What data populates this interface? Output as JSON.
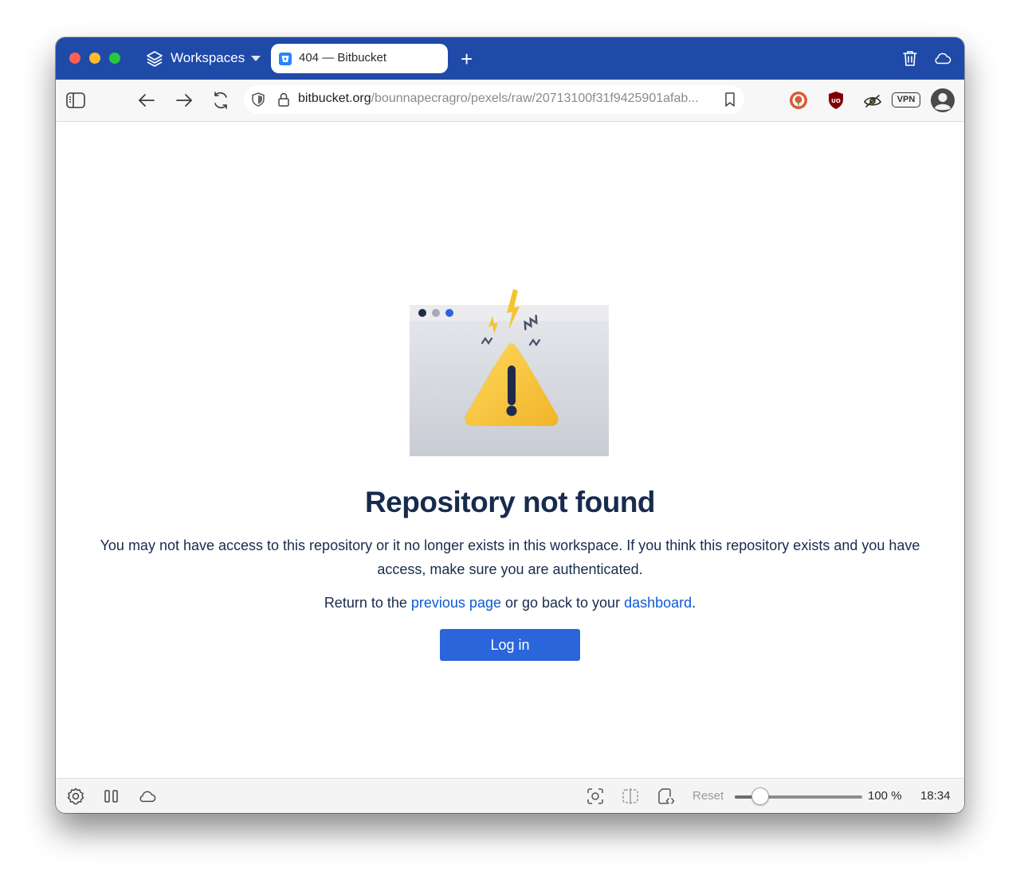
{
  "browser": {
    "workspaces_label": "Workspaces",
    "tab": {
      "title": "404 — Bitbucket",
      "favicon": "bitbucket-icon"
    },
    "new_tab_label": "+",
    "url": {
      "domain": "bitbucket.org",
      "path": "/bounnapecragro/pexels/raw/20713100f31f9425901afab..."
    },
    "toolbar_icons": [
      "sidebar-toggle-icon",
      "back-arrow-icon",
      "forward-arrow-icon",
      "reload-icon",
      "trash-icon",
      "cloud-icon"
    ],
    "extensions": [
      "duckduckgo-icon",
      "ublock-icon",
      "eye-extension-icon",
      "vpn-badge",
      "profile-avatar"
    ],
    "vpn_label": "VPN"
  },
  "page": {
    "heading": "Repository not found",
    "description": "You may not have access to this repository or it no longer exists in this workspace. If you think this repository exists and you have access, make sure you are authenticated.",
    "return_prefix": "Return to the ",
    "previous_page_link": "previous page",
    "return_middle": " or go back to your ",
    "dashboard_link": "dashboard",
    "return_suffix": ".",
    "login_button": "Log in"
  },
  "statusbar": {
    "reset_label": "Reset",
    "zoom_label": "100 %",
    "zoom_level": 0.2,
    "time": "18:34"
  },
  "colors": {
    "tabbar": "#1f4aa8",
    "heading": "#172b4d",
    "link": "#0c5bd6",
    "button": "#2a65db",
    "warning": "#f5c542"
  }
}
